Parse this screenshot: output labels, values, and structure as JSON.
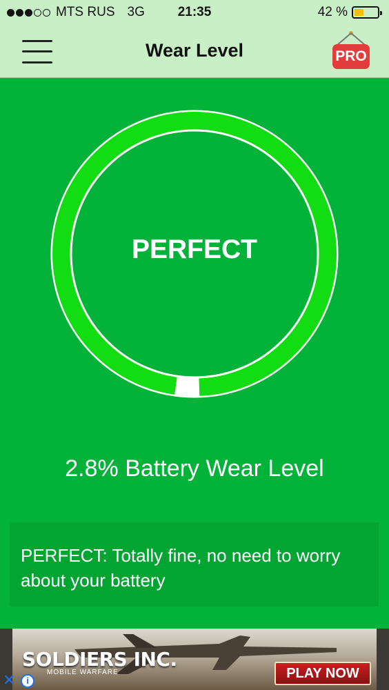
{
  "status_bar": {
    "signal_dots_filled": 3,
    "signal_dots_total": 5,
    "carrier": "MTS RUS",
    "network": "3G",
    "time": "21:35",
    "battery_percent_text": "42 %",
    "battery_level": 0.42,
    "battery_color": "#f2c000"
  },
  "nav": {
    "menu_icon": "hamburger-menu-icon",
    "title": "Wear Level",
    "pro_badge": "PRO"
  },
  "gauge": {
    "status_label": "PERFECT",
    "wear_fraction": 0.028,
    "ring_color": "#12dd12",
    "outline_color": "#ffffff"
  },
  "wear_level_text": "2.8% Battery Wear Level",
  "info_message": "PERFECT: Totally fine, no need to worry about your battery",
  "ad": {
    "brand": "SOLDIERS INC.",
    "tagline": "MOBILE WARFARE",
    "cta": "PLAY NOW",
    "close_icon": "close-icon",
    "info_icon": "info-icon"
  },
  "colors": {
    "background": "#03b239",
    "header": "#c8efc6",
    "info_box": "#02a532",
    "accent_red": "#e23c3c"
  }
}
